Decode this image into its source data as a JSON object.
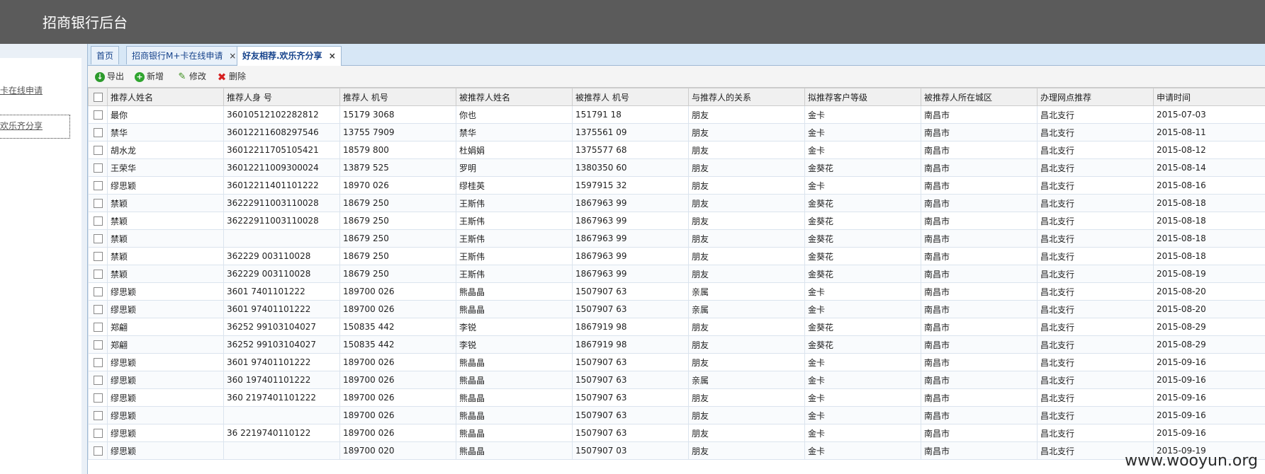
{
  "header": {
    "title": "招商银行后台"
  },
  "sidebar": {
    "items": [
      {
        "label": "卡在线申请"
      },
      {
        "label": "欢乐齐分享"
      }
    ]
  },
  "tabs": [
    {
      "label": "首页",
      "closable": false
    },
    {
      "label": "招商银行M+卡在线申请",
      "closable": true
    },
    {
      "label": "好友相荐.欢乐齐分享",
      "closable": true,
      "active": true
    }
  ],
  "close_glyph": "×",
  "toolbar": {
    "export_label": "导出",
    "add_label": "新增",
    "edit_label": "修改",
    "delete_label": "删除"
  },
  "table": {
    "columns": [
      "推荐人姓名",
      "推荐人身 号",
      "推荐人 机号",
      "被推荐人姓名",
      "被推荐人 机号",
      "与推荐人的关系",
      "拟推荐客户等级",
      "被推荐人所在城区",
      "办理网点推荐",
      "申请时间"
    ],
    "rows": [
      [
        "最你",
        "36010512102282812",
        "15179 3068",
        "你也",
        "151791 18",
        "朋友",
        "金卡",
        "南昌市",
        "昌北支行",
        "2015-07-03"
      ],
      [
        "禁华",
        "36012211608297546",
        "13755 7909",
        "禁华",
        "1375561 09",
        "朋友",
        "金卡",
        "南昌市",
        "昌北支行",
        "2015-08-11"
      ],
      [
        "胡水龙",
        "36012211705105421",
        "18579 800",
        "杜娟娟",
        "1375577 68",
        "朋友",
        "金卡",
        "南昌市",
        "昌北支行",
        "2015-08-12"
      ],
      [
        "王荣华",
        "36012211009300024",
        "13879 525",
        "罗明",
        "1380350 60",
        "朋友",
        "金葵花",
        "南昌市",
        "昌北支行",
        "2015-08-14"
      ],
      [
        "缪思颖",
        "36012211401101222",
        "18970 026",
        "缪桂英",
        "1597915 32",
        "朋友",
        "金卡",
        "南昌市",
        "昌北支行",
        "2015-08-16"
      ],
      [
        "禁颖",
        "36222911003110028",
        "18679 250",
        "王斯伟",
        "1867963 99",
        "朋友",
        "金葵花",
        "南昌市",
        "昌北支行",
        "2015-08-18"
      ],
      [
        "禁颖",
        "36222911003110028",
        "18679 250",
        "王斯伟",
        "1867963 99",
        "朋友",
        "金葵花",
        "南昌市",
        "昌北支行",
        "2015-08-18"
      ],
      [
        "禁颖",
        "",
        "18679 250",
        "王斯伟",
        "1867963 99",
        "朋友",
        "金葵花",
        "南昌市",
        "昌北支行",
        "2015-08-18"
      ],
      [
        "禁颖",
        "362229 003110028",
        "18679 250",
        "王斯伟",
        "1867963 99",
        "朋友",
        "金葵花",
        "南昌市",
        "昌北支行",
        "2015-08-18"
      ],
      [
        "禁颖",
        "362229 003110028",
        "18679 250",
        "王斯伟",
        "1867963 99",
        "朋友",
        "金葵花",
        "南昌市",
        "昌北支行",
        "2015-08-19"
      ],
      [
        "缪思颖",
        "3601 7401101222",
        "189700 026",
        "熊晶晶",
        "1507907 63",
        "亲属",
        "金卡",
        "南昌市",
        "昌北支行",
        "2015-08-20"
      ],
      [
        "缪思颖",
        "3601 97401101222",
        "189700 026",
        "熊晶晶",
        "1507907 63",
        "亲属",
        "金卡",
        "南昌市",
        "昌北支行",
        "2015-08-20"
      ],
      [
        "郑翩",
        "36252 99103104027",
        "150835 442",
        "李锐",
        "1867919 98",
        "朋友",
        "金葵花",
        "南昌市",
        "昌北支行",
        "2015-08-29"
      ],
      [
        "郑翩",
        "36252 99103104027",
        "150835 442",
        "李锐",
        "1867919 98",
        "朋友",
        "金葵花",
        "南昌市",
        "昌北支行",
        "2015-08-29"
      ],
      [
        "缪思颖",
        "3601 97401101222",
        "189700 026",
        "熊晶晶",
        "1507907 63",
        "朋友",
        "金卡",
        "南昌市",
        "昌北支行",
        "2015-09-16"
      ],
      [
        "缪思颖",
        "360 197401101222",
        "189700 026",
        "熊晶晶",
        "1507907 63",
        "亲属",
        "金卡",
        "南昌市",
        "昌北支行",
        "2015-09-16"
      ],
      [
        "缪思颖",
        "360 2197401101222",
        "189700 026",
        "熊晶晶",
        "1507907 63",
        "朋友",
        "金卡",
        "南昌市",
        "昌北支行",
        "2015-09-16"
      ],
      [
        "缪思颖",
        "",
        "189700 026",
        "熊晶晶",
        "1507907 63",
        "朋友",
        "金卡",
        "南昌市",
        "昌北支行",
        "2015-09-16"
      ],
      [
        "缪思颖",
        "36 2219740110122",
        "189700 026",
        "熊晶晶",
        "1507907 63",
        "朋友",
        "金卡",
        "南昌市",
        "昌北支行",
        "2015-09-16"
      ],
      [
        "缪思颖",
        "",
        "189700 020",
        "熊晶晶",
        "1507907 03",
        "朋友",
        "金卡",
        "南昌市",
        "昌北支行",
        "2015-09-19"
      ]
    ]
  },
  "watermark": "www.wooyun.org"
}
